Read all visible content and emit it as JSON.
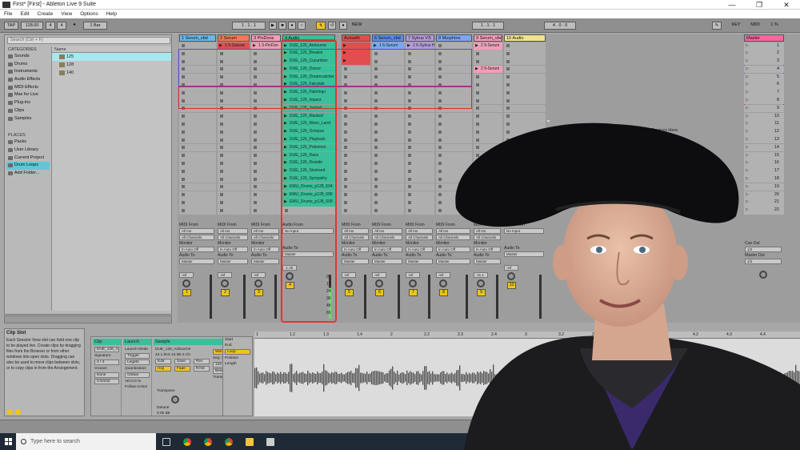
{
  "window": {
    "title": "First*  [First] - Ableton Live 9 Suite",
    "controls": [
      "—",
      "❐",
      "✕"
    ]
  },
  "menu": [
    "File",
    "Edit",
    "Create",
    "View",
    "Options",
    "Help"
  ],
  "controlbar": {
    "tap": "TAP",
    "tempo": "128.00",
    "sig_num": "4",
    "sig_den": "4",
    "quant": "1 Bar",
    "pos": "1 . 1 . 1",
    "new": "NEW",
    "pos2": "1 . 1 . 1",
    "end": "4 . 0 . 0",
    "key": "KEY",
    "midi": "MIDI",
    "cpu": "1 %"
  },
  "browser": {
    "search_placeholder": "Search (Ctrl + F)",
    "categories_title": "CATEGORIES",
    "categories": [
      "Sounds",
      "Drums",
      "Instruments",
      "Audio Effects",
      "MIDI Effects",
      "Max for Live",
      "Plug-ins",
      "Clips",
      "Samples"
    ],
    "places_title": "PLACES",
    "places": [
      "Packs",
      "User Library",
      "Current Project",
      "Drum Loops",
      "Add Folder..."
    ],
    "active_place": "Drum Loops",
    "name_header": "Name",
    "files": [
      "125",
      "128",
      "140"
    ]
  },
  "tracks": [
    {
      "name": "1 Serum_vbd",
      "color": "#68b8e8"
    },
    {
      "name": "2 Serum",
      "color": "#f07a58"
    },
    {
      "name": "3 PinDons",
      "color": "#f39db8"
    },
    {
      "name": "4 Audio",
      "color": "#3bbf9b"
    },
    {
      "name": "Acousth",
      "color": "#e24d4d"
    },
    {
      "name": "6 Serum_vbd",
      "color": "#5a8ee6"
    },
    {
      "name": "7 Sylrus VS",
      "color": "#b59ad8"
    },
    {
      "name": "8 Morphine",
      "color": "#7ba6f2"
    },
    {
      "name": "9 Serum_vbd",
      "color": "#f39db8"
    },
    {
      "name": "10 Audio",
      "color": "#f0e48a"
    }
  ],
  "track_clips": {
    "t2": [
      "1 5-Saturat"
    ],
    "t3": [
      "1 3-PinDon"
    ],
    "t6": [
      "1 6-Serum"
    ],
    "t7": [
      "1 6-Sylrus H"
    ],
    "t9a": [
      "2 9-Serum"
    ],
    "t9b": [
      "2 9-Serum"
    ]
  },
  "audio_clips": [
    "DUE_126_Airbourne",
    "DUE_126_Breakin",
    "DUE_126_Cucumber",
    "DUE_126_Dance",
    "DUE_126_Dreamcatcher",
    "DUE_126_Fairytale",
    "DUE_126_Flamingo",
    "DUE_126_Impact",
    "DUE_126_Jacked",
    "DUE_126_Masked",
    "DUE_126_Moon_Land",
    "DUE_126_Octopus",
    "DUE_126_Playback",
    "DUE_126_Pokemon",
    "DUE_126_Race",
    "DUE_126_Rewide",
    "DUE_126_Sirstreed",
    "DUE_126_Sympathy",
    "EMU_Drums_p128_604",
    "EMU_Drums_p128_606",
    "EMU_Drums_p128_609"
  ],
  "session": {
    "drop_hint": "Drop Files and Devices Here",
    "scene_numbers": [
      "1",
      "2",
      "3",
      "4",
      "5",
      "6",
      "7",
      "8",
      "9",
      "10",
      "11",
      "12",
      "13",
      "14",
      "15",
      "16",
      "17",
      "18",
      "19",
      "20",
      "21",
      "22"
    ],
    "master_name": "Master",
    "midi_from": "MIDI From",
    "audio_from": "Audio From",
    "all_ins": "All Ins",
    "no_input": "No Input",
    "all_channels": "All Channels",
    "monitor": "Monitor",
    "in_auto_off": "In  Auto  Off",
    "audio_to": "Audio To",
    "master": "Master",
    "cue_out": "Cue Out",
    "cue_out_val": "1/2",
    "master_out": "Master Out",
    "master_out_val": "1/2",
    "vol_inf": "-inf",
    "vol_a": "-1.40",
    "vol_b": "-11.1",
    "track_numbers": [
      "1",
      "2",
      "3",
      "4",
      "5",
      "6",
      "7",
      "8",
      "9",
      "10"
    ],
    "db_scale": [
      "0",
      "12",
      "24",
      "36",
      "48",
      "60"
    ]
  },
  "info": {
    "title": "Clip Slot",
    "text": "Each Session View slot can hold one clip to be played live. Create clips by dragging files from the Browser or from other windows into open slots. Dragging can also be used to move clips between slots, or to copy clips in from the Arrangement."
  },
  "clip_detail": {
    "clip": "Clip",
    "launch": "Launch",
    "sample": "Sample",
    "clip_name": "DUE_126_Airb",
    "signature": "Signature",
    "sig": "4  /  4",
    "groove": "Groove",
    "groove_val": "None",
    "commit": "Commit",
    "launch_mode": "Launch Mode",
    "trigger": "Trigger",
    "legato": "Legato",
    "quant": "Quantization",
    "global": "Global",
    "vel": "Vel",
    "vel_val": "0.0 %",
    "follow": "Follow Action",
    "sample_name": "DUE_126_Airbourne",
    "sample_info": "44.1 kHz 24 Bit 2 Ch",
    "warp": "Warp",
    "edit": "Edit",
    "save": "Save",
    "rev": "Rev",
    "hiq": "HiQ",
    "fade": "Fade",
    "ram": "RAM",
    "seg_bpm": "Seg. BPM",
    "bpm": "126.00",
    "beats": "Beats",
    "transients": "Transients",
    "transpose": "Transpose",
    "detune": "Detune",
    "gain": "0.00 dB",
    "start": "Start",
    "end": "End",
    "loop": "Loop",
    "position": "Position",
    "length": "Length"
  },
  "ruler": [
    "1",
    "1.2",
    "1.3",
    "1.4",
    "2",
    "2.2",
    "2.3",
    "2.4",
    "3",
    "3.2",
    "3.3",
    "3.4",
    "4",
    "4.2",
    "4.3",
    "4.4"
  ],
  "taskbar": {
    "search_placeholder": "Type here to search"
  },
  "colors": {
    "accent_teal": "#3bbf9b",
    "selection_blue": "#5a4ad0",
    "selection_red": "#d92c2c",
    "track_yellow": "#f0c419"
  }
}
